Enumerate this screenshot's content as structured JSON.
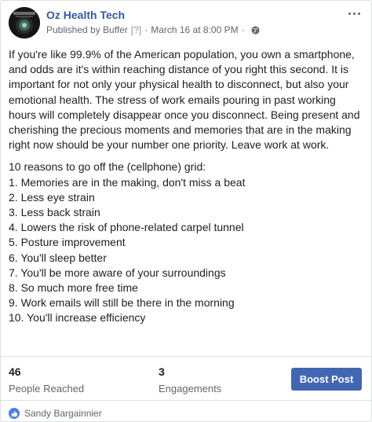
{
  "post": {
    "page_name": "Oz Health Tech",
    "published_by": "Published by Buffer",
    "help_marker": "[?]",
    "sep1": "·",
    "date": "March 16 at 8:00 PM",
    "sep2": "·",
    "privacy_icon": "globe-icon",
    "avatar_icon": "page-avatar",
    "more_icon": "more-options-icon",
    "intro_text": "If you're like 99.9% of the American population, you own a smartphone, and odds are it's within reaching distance of you right this second. It is important for not only your physical health to disconnect, but also your emotional health. The stress of work emails pouring in past working hours will completely disappear once you disconnect. Being present and cherishing the precious moments and memories that are in the making right now should be your number one priority. Leave work at work.",
    "list_title": "10 reasons to go off the (cellphone) grid:",
    "list_items": [
      "1. Memories are in the making, don't miss a beat",
      "2. Less eye strain",
      "3. Less back strain",
      "4. Lowers the risk of phone-related carpel tunnel",
      "5. Posture improvement",
      "6. You'll sleep better",
      "7. You'll be more aware of your surroundings",
      "8. So much more free time",
      "9. Work emails will still be there in the morning",
      "10. You'll increase efficiency"
    ]
  },
  "insights": {
    "reached_count": "46",
    "reached_label": "People Reached",
    "engagements_count": "3",
    "engagements_label": "Engagements",
    "boost_label": "Boost Post"
  },
  "reactions": {
    "icon": "like-icon",
    "names": "Sandy Bargainnier"
  },
  "colors": {
    "link": "#385898",
    "button": "#4267b2",
    "like": "#4a7fe0",
    "muted": "#606770"
  }
}
